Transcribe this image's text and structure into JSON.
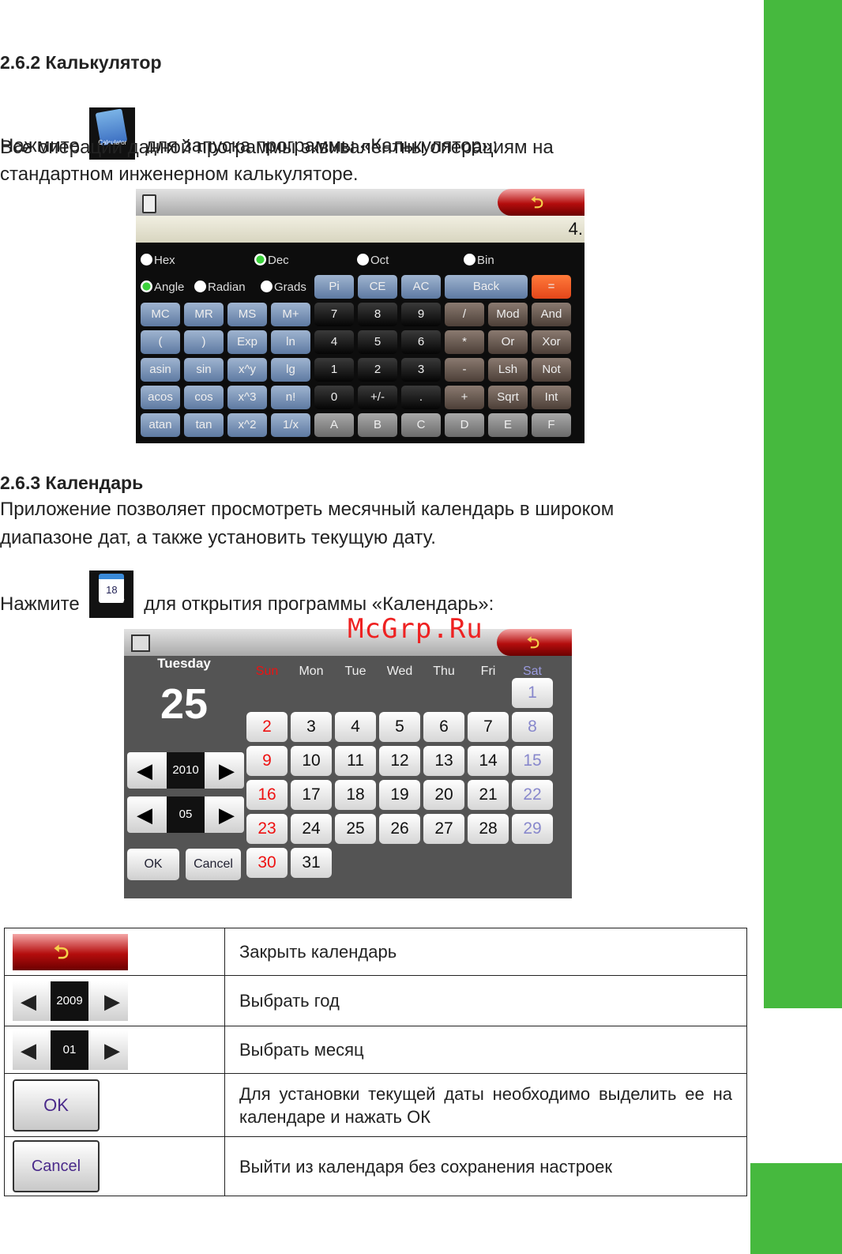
{
  "calc_section": {
    "heading": "2.6.2 Калькулятор",
    "line1_pre": "Нажмите",
    "icon_label": "Calculator",
    "line1_post": "для запуска программы «Калькулятор»:",
    "line2": "Все операции данной программы эквивалентны операциям на",
    "line3": "стандартном инженерном калькуляторе."
  },
  "calculator": {
    "display": "4.",
    "radios_row1": [
      {
        "label": "Hex",
        "on": false
      },
      {
        "label": "Dec",
        "on": true
      },
      {
        "label": "Oct",
        "on": false
      },
      {
        "label": "Bin",
        "on": false
      }
    ],
    "radios_row2": [
      {
        "label": "Angle",
        "on": true
      },
      {
        "label": "Radian",
        "on": false
      },
      {
        "label": "Grads",
        "on": false
      }
    ],
    "row2_buttons": [
      "Pi",
      "CE",
      "AC",
      "Back",
      "="
    ],
    "rows": [
      [
        "MC",
        "MR",
        "MS",
        "M+",
        "7",
        "8",
        "9",
        "/",
        "Mod",
        "And"
      ],
      [
        "(",
        ")",
        "Exp",
        "ln",
        "4",
        "5",
        "6",
        "*",
        "Or",
        "Xor"
      ],
      [
        "asin",
        "sin",
        "x^y",
        "lg",
        "1",
        "2",
        "3",
        "-",
        "Lsh",
        "Not"
      ],
      [
        "acos",
        "cos",
        "x^3",
        "n!",
        "0",
        "+/-",
        ".",
        "+",
        "Sqrt",
        "Int"
      ],
      [
        "atan",
        "tan",
        "x^2",
        "1/x",
        "A",
        "B",
        "C",
        "D",
        "E",
        "F"
      ]
    ]
  },
  "cal_section": {
    "heading": "2.6.3 Календарь",
    "line1": "Приложение позволяет просмотреть месячный календарь в широком",
    "line2": "диапазоне дат, а также установить текущую дату.",
    "line3_pre": "Нажмите",
    "icon_label": "Calendar",
    "icon_number": "18",
    "line3_post": "для открытия программы «Календарь»:"
  },
  "calendar": {
    "weekday": "Tuesday",
    "day": "25",
    "year": "2010",
    "month": "05",
    "ok": "OK",
    "cancel": "Cancel",
    "weekdays": [
      "Sun",
      "Mon",
      "Tue",
      "Wed",
      "Thu",
      "Fri",
      "Sat"
    ],
    "first_col": 6,
    "days_in_month": 31
  },
  "watermark": "McGrp.Ru",
  "legend": {
    "rows": [
      {
        "text": "Закрыть календарь"
      },
      {
        "text": "Выбрать год",
        "value": "2009"
      },
      {
        "text": "Выбрать месяц",
        "value": "01"
      },
      {
        "text": "Для установки текущей даты необходимо выделить ее на календаре и нажать ОК",
        "button": "OK"
      },
      {
        "text": "Выйти из календаря без сохранения настроек",
        "button": "Cancel"
      }
    ]
  }
}
